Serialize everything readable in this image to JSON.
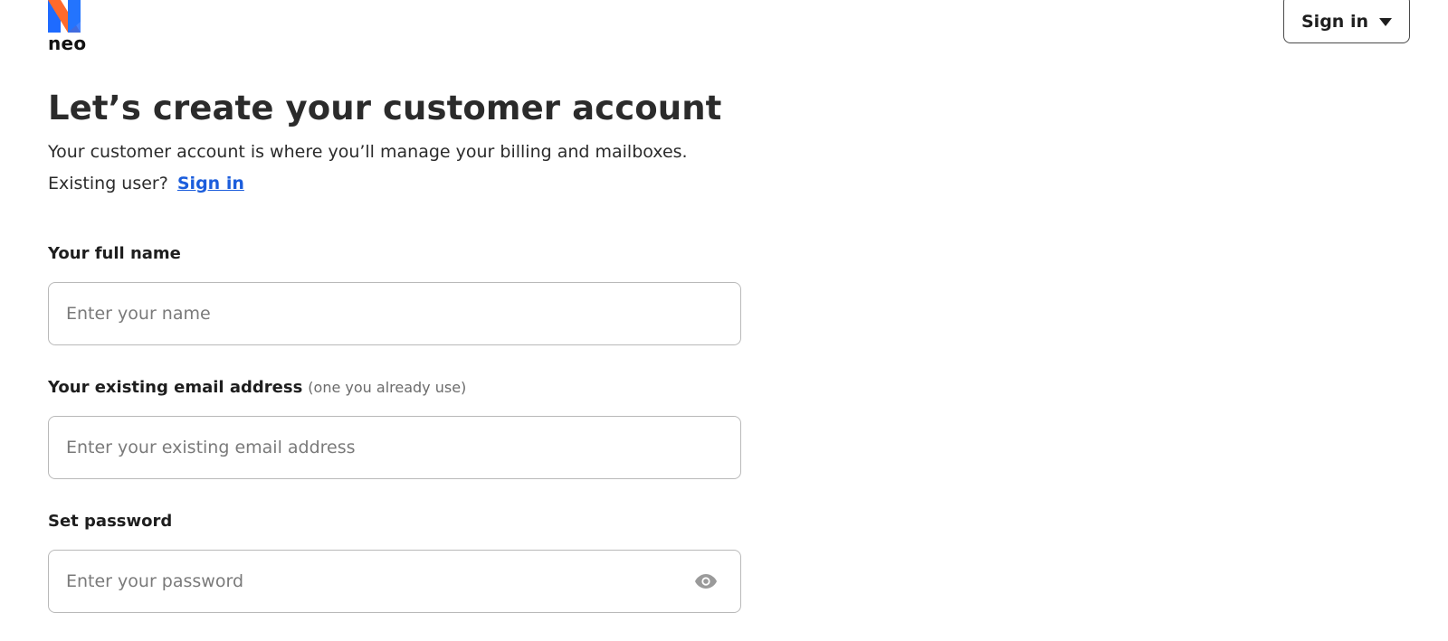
{
  "brand": {
    "name": "neo",
    "colors": {
      "blue": "#1E6BFF",
      "orange": "#FF6A2B",
      "light_blue": "#3FA9F5"
    }
  },
  "header": {
    "signin_dropdown_label": "Sign in",
    "signin_dropdown_icon": "caret-down-icon"
  },
  "main": {
    "title": "Let’s create your customer account",
    "subtitle": "Your customer account is where you’ll manage your billing and mailboxes.",
    "existing_user_prefix": "Existing user?",
    "existing_user_link": "Sign in",
    "link_color": "#1b5ddc"
  },
  "form": {
    "name": {
      "label": "Your full name",
      "placeholder": "Enter your name",
      "value": ""
    },
    "email": {
      "label": "Your existing email address",
      "hint": "(one you already use)",
      "placeholder": "Enter your existing email address",
      "value": ""
    },
    "password": {
      "label": "Set password",
      "placeholder": "Enter your password",
      "value": "",
      "toggle_icon": "eye-icon"
    }
  }
}
